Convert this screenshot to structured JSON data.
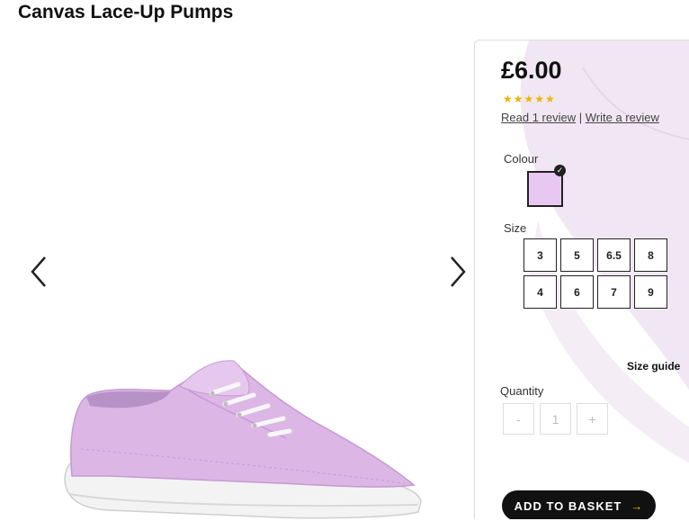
{
  "product": {
    "title": "Canvas Lace-Up Pumps"
  },
  "gallery": {
    "prev_icon": "chevron-left",
    "next_icon": "chevron-right"
  },
  "pricing": {
    "price": "£6.00",
    "rating": 5,
    "rating_max": 5,
    "stars": "★★★★★",
    "read_reviews": "Read 1 review",
    "separator": "|",
    "write_review": "Write a review"
  },
  "colour": {
    "label": "Colour",
    "selected_hex": "#e8c8f2",
    "check": "✓"
  },
  "size": {
    "label": "Size",
    "options": [
      "3",
      "5",
      "6.5",
      "8",
      "4",
      "6",
      "7",
      "9"
    ],
    "guide": "Size guide"
  },
  "quantity": {
    "label": "Quantity",
    "decrement": "-",
    "value": "1",
    "increment": "+"
  },
  "basket": {
    "label": "ADD TO BASKET",
    "arrow": "→",
    "color": "#111111",
    "accent": "#f0b400"
  }
}
